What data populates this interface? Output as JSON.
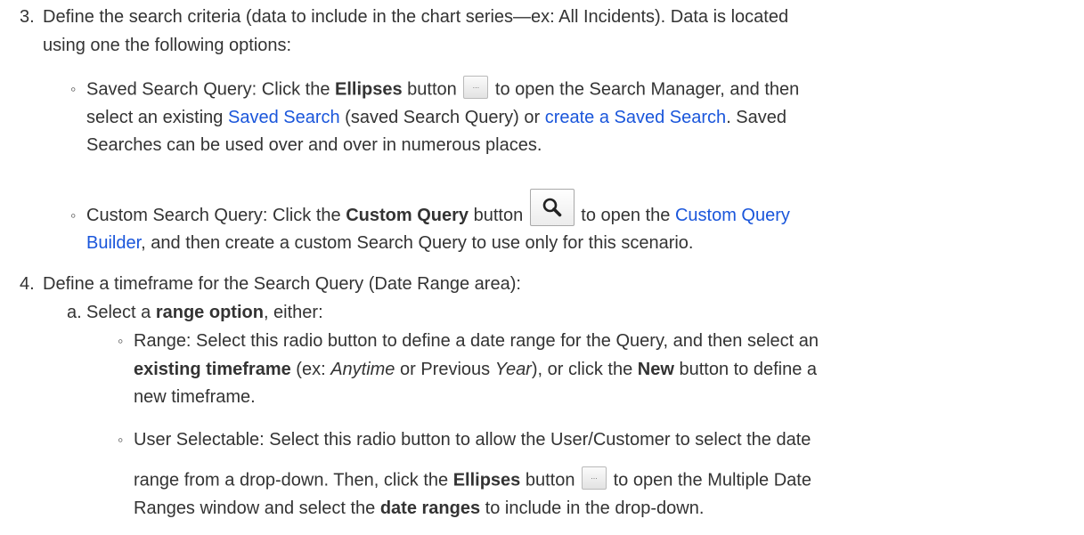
{
  "step3": {
    "number": "3.",
    "line1": "Define the search criteria (data to include in the chart series—ex: All Incidents). Data is located",
    "line2": "using one the following options:",
    "saved": {
      "intro": "Saved Search Query: Click the ",
      "button_name": "Ellipses",
      "after_button_word": " button ",
      "after_icon": " to open the Search Manager, and then",
      "l2_a": "select an existing ",
      "link1": "Saved Search",
      "l2_b": " (saved Search Query) or ",
      "link2": "create a Saved Search",
      "l2_c": ". Saved",
      "l3": "Searches can be used over and over in numerous places."
    },
    "custom": {
      "intro": "Custom Search Query: Click the ",
      "button_name": "Custom Query",
      "after_button_word": " button ",
      "after_icon": " to open the ",
      "link_a": "Custom Query",
      "link_b": "Builder",
      "l2_rest": ", and then create a custom Search Query to use only for this scenario."
    }
  },
  "step4": {
    "number": "4.",
    "line1": "Define a timeframe for the Search Query (Date Range area):",
    "sub_a": {
      "letter": "a.",
      "pre": "Select a ",
      "bold": "range option",
      "post": ", either:"
    },
    "range": {
      "l1": "Range: Select this radio button to define a date range for the Query, and then select an",
      "l2_bold1": "existing timeframe",
      "l2_a": " (ex: ",
      "l2_ital1": "Anytime",
      "l2_b": " or Previous ",
      "l2_ital2": "Year",
      "l2_c": "), or click the ",
      "l2_bold2": "New",
      "l2_d": " button to define a",
      "l3": "new timeframe."
    },
    "user_selectable": {
      "l1": "User Selectable: Select this radio button to allow the User/Customer to select the date",
      "l2_a": "range from a drop-down. Then, click the ",
      "l2_bold": "Ellipses",
      "l2_b": " button ",
      "l2_c": " to open the Multiple Date",
      "l3_a": "Ranges window and select the ",
      "l3_bold": "date ranges",
      "l3_b": " to include in the drop-down."
    }
  },
  "icons": {
    "ellipsis": "ellipsis-button-icon",
    "search": "magnifier-icon"
  },
  "colors": {
    "text": "#333333",
    "link": "#1a56db"
  }
}
